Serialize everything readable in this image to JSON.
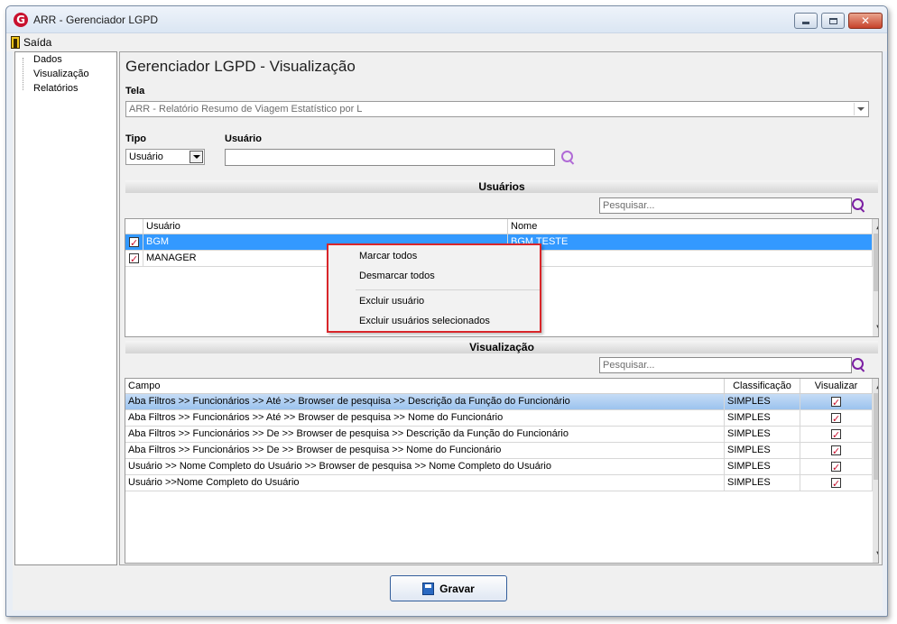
{
  "window": {
    "title": "ARR - Gerenciador LGPD",
    "logo": "G"
  },
  "menu": {
    "exit_label": "Saída"
  },
  "tree": {
    "items": [
      "Dados",
      "Visualização",
      "Relatórios"
    ]
  },
  "page": {
    "title": "Gerenciador LGPD - Visualização"
  },
  "tela": {
    "label": "Tela",
    "value": "ARR - Relatório Resumo de Viagem Estatístico por L"
  },
  "tipo": {
    "label": "Tipo",
    "value": "Usuário"
  },
  "usuario_filter": {
    "label": "Usuário",
    "value": ""
  },
  "usuarios": {
    "section_title": "Usuários",
    "search_placeholder": "Pesquisar...",
    "columns": [
      "Usuário",
      "Nome"
    ],
    "rows": [
      {
        "usuario": "BGM",
        "nome": "BGM TESTE",
        "checked": true
      },
      {
        "usuario": "MANAGER",
        "nome": "",
        "checked": true
      }
    ]
  },
  "context_menu": {
    "items": [
      "Marcar todos",
      "Desmarcar todos",
      "Excluir usuário",
      "Excluir usuários selecionados"
    ]
  },
  "visualizacao": {
    "section_title": "Visualização",
    "search_placeholder": "Pesquisar...",
    "columns": [
      "Campo",
      "Classificação",
      "Visualizar"
    ],
    "rows": [
      {
        "campo": "Aba Filtros >> Funcionários >> Até >> Browser de pesquisa >> Descrição da Função do Funcionário",
        "classificacao": "SIMPLES",
        "visualizar": true
      },
      {
        "campo": "Aba Filtros >> Funcionários >> Até >> Browser de pesquisa >> Nome do Funcionário",
        "classificacao": "SIMPLES",
        "visualizar": true
      },
      {
        "campo": "Aba Filtros >> Funcionários >> De >> Browser de pesquisa >> Descrição da Função do Funcionário",
        "classificacao": "SIMPLES",
        "visualizar": true
      },
      {
        "campo": "Aba Filtros >> Funcionários >> De >> Browser de pesquisa >> Nome do Funcionário",
        "classificacao": "SIMPLES",
        "visualizar": true
      },
      {
        "campo": "Usuário >> Nome Completo do Usuário >> Browser de pesquisa >> Nome Completo do Usuário",
        "classificacao": "SIMPLES",
        "visualizar": true
      },
      {
        "campo": "Usuário >>Nome Completo do Usuário",
        "classificacao": "SIMPLES",
        "visualizar": true
      }
    ]
  },
  "footer": {
    "save_label": "Gravar"
  },
  "colors": {
    "accent": "#3399ff",
    "check": "#c8102e",
    "highlight_border": "#d9262a",
    "search_icon": "#7b1fa2"
  }
}
